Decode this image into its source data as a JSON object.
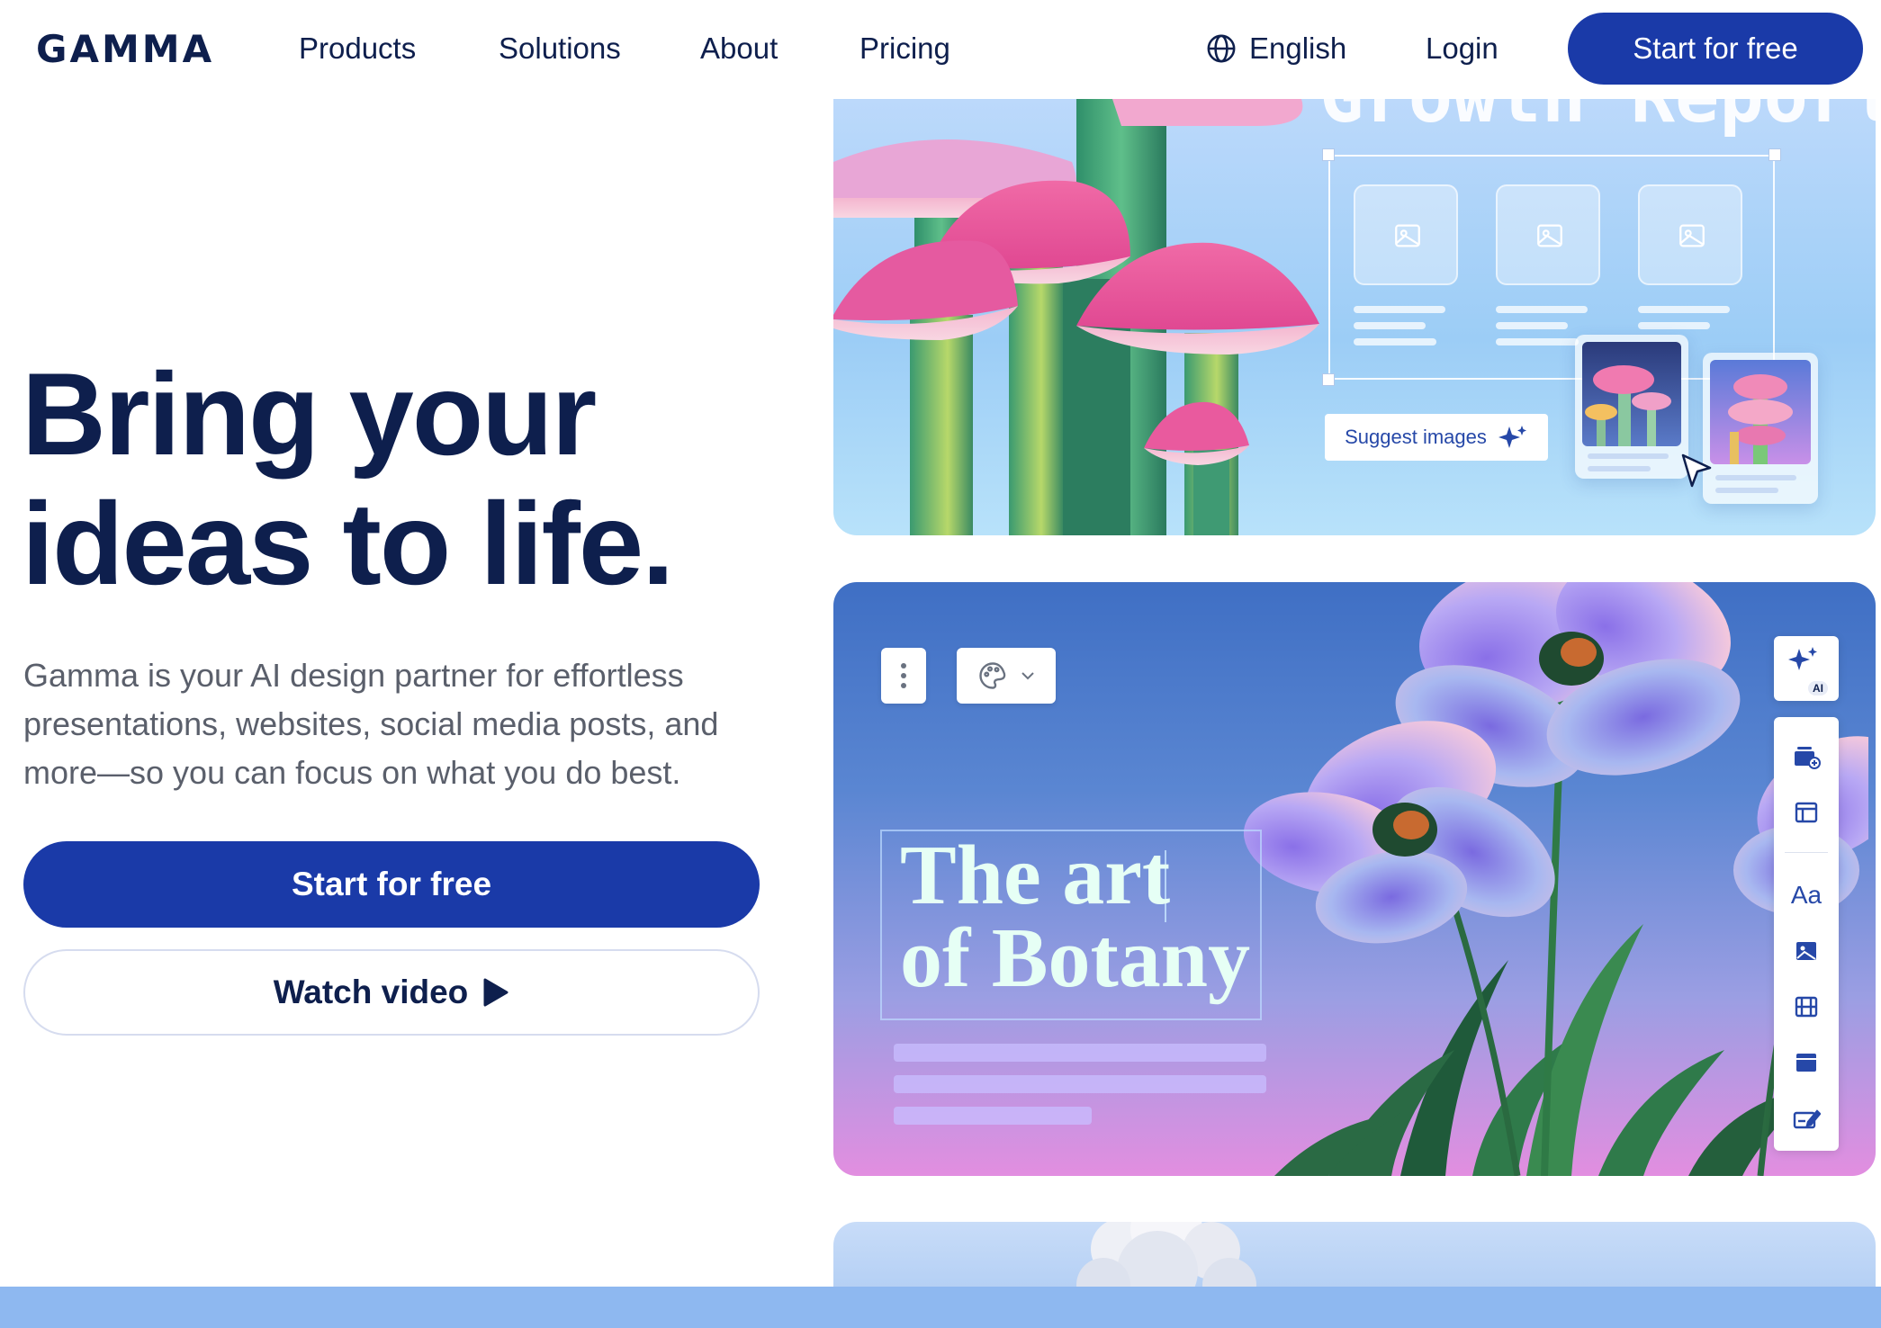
{
  "nav": {
    "logo": "GAMMA",
    "links": [
      "Products",
      "Solutions",
      "About",
      "Pricing"
    ],
    "language": "English",
    "login": "Login",
    "cta": "Start for free"
  },
  "hero": {
    "title_line1": "Bring your",
    "title_line2": "ideas to life.",
    "subtitle": "Gamma is your AI design partner for effortless presentations, websites, social media posts, and more—so you can focus on what you do best.",
    "primary_cta": "Start for free",
    "secondary_cta": "Watch video"
  },
  "card_growth": {
    "title": "Growth Report",
    "suggest_label": "Suggest images"
  },
  "card_botany": {
    "title_line1": "The art",
    "title_line2": "of Botany",
    "ai_badge": "AI",
    "font_tool_label": "Aa"
  },
  "colors": {
    "brand": "#1a3aa8",
    "ink": "#0e1f4d",
    "muted": "#5a5f6b"
  }
}
